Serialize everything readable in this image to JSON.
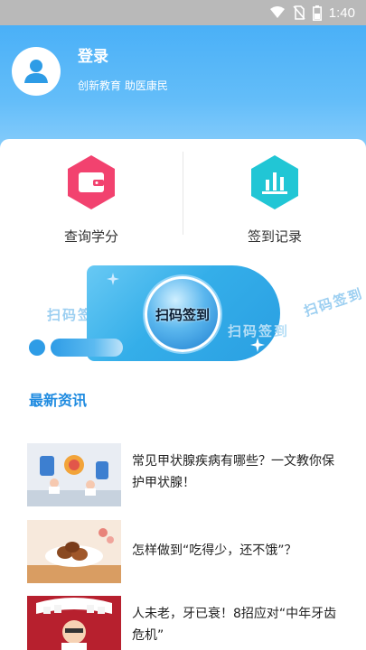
{
  "status_bar": {
    "time": "1:40",
    "icons": [
      "wifi-icon",
      "no-sim-icon",
      "battery-icon"
    ]
  },
  "header": {
    "title": "登录",
    "subtitle": "创新教育 助医康民",
    "avatar_icon": "user-icon"
  },
  "quick_actions": [
    {
      "label": "查询学分",
      "icon": "wallet-icon",
      "color": "#f2426f"
    },
    {
      "label": "签到记录",
      "icon": "bar-chart-icon",
      "color": "#21c6d5"
    }
  ],
  "banner": {
    "button_label": "扫码签到",
    "bg_text": "扫码签到"
  },
  "news": {
    "section_title": "最新资讯",
    "items": [
      {
        "title": "常见甲状腺疾病有哪些？一文教你保护甲状腺！"
      },
      {
        "title": "怎样做到“吃得少，还不饿”？"
      },
      {
        "title": "人未老，牙已衰！8招应对“中年牙齿危机”"
      }
    ]
  },
  "colors": {
    "accent": "#1f8be0",
    "header": "#4ab0f7"
  }
}
